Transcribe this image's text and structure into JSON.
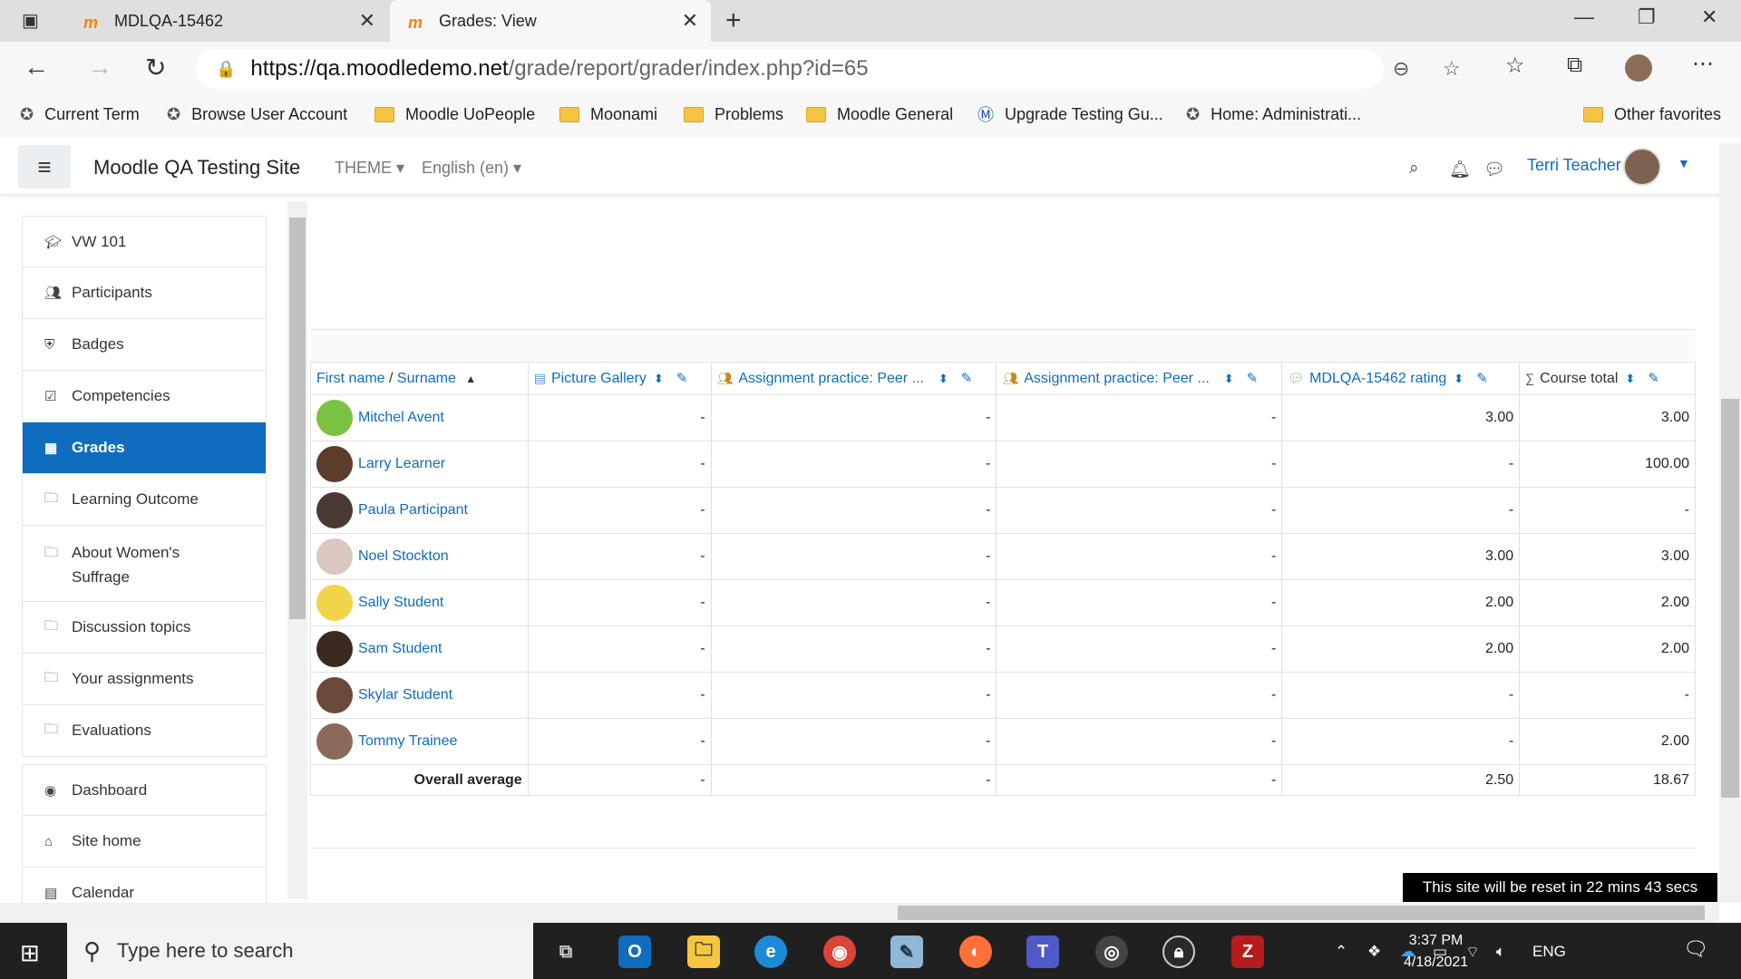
{
  "browser": {
    "tabs": [
      {
        "title": "MDLQA-15462"
      },
      {
        "title": "Grades: View"
      }
    ],
    "url_host": "https://qa.moodledemo.net",
    "url_path": "/grade/report/grader/index.php?id=65",
    "bookmarks": [
      "Current Term",
      "Browse User Account",
      "Moodle UoPeople",
      "Moonami",
      "Problems",
      "Moodle General",
      "Upgrade Testing Gu...",
      "Home: Administrati..."
    ],
    "other_favorites": "Other favorites"
  },
  "moodle": {
    "site_name": "Moodle QA Testing Site",
    "theme_menu": "THEME",
    "lang_menu": "English (en)",
    "user_name": "Terri Teacher"
  },
  "sidebar": {
    "items": [
      {
        "label": "VW 101",
        "icon": "graduation-cap-icon"
      },
      {
        "label": "Participants",
        "icon": "users-icon"
      },
      {
        "label": "Badges",
        "icon": "shield-icon"
      },
      {
        "label": "Competencies",
        "icon": "check-square-icon"
      },
      {
        "label": "Grades",
        "icon": "table-icon",
        "active": true
      },
      {
        "label": "Learning Outcome",
        "icon": "folder-icon"
      },
      {
        "label": "About Women's Suffrage",
        "icon": "folder-icon"
      },
      {
        "label": "Discussion topics",
        "icon": "folder-icon"
      },
      {
        "label": "Your assignments",
        "icon": "folder-icon"
      },
      {
        "label": "Evaluations",
        "icon": "folder-icon"
      },
      {
        "label": "Dashboard",
        "icon": "dashboard-icon"
      },
      {
        "label": "Site home",
        "icon": "home-icon"
      },
      {
        "label": "Calendar",
        "icon": "calendar-icon"
      }
    ]
  },
  "grader": {
    "name_header_first": "First name",
    "name_header_sep": " / ",
    "name_header_last": "Surname",
    "columns": [
      "Picture Gallery",
      "Assignment practice: Peer ...",
      "Assignment practice: Peer ...",
      "MDLQA-15462 rating",
      "Course total"
    ],
    "rows": [
      {
        "name": "Mitchel Avent",
        "grades": [
          "-",
          "-",
          "-",
          "3.00",
          "3.00"
        ],
        "avatar_color": "#7bc142"
      },
      {
        "name": "Larry Learner",
        "grades": [
          "-",
          "-",
          "-",
          "-",
          "100.00"
        ],
        "avatar_color": "#5a3d2b"
      },
      {
        "name": "Paula Participant",
        "grades": [
          "-",
          "-",
          "-",
          "-",
          "-"
        ],
        "avatar_color": "#4a3a36"
      },
      {
        "name": "Noel Stockton",
        "grades": [
          "-",
          "-",
          "-",
          "3.00",
          "3.00"
        ],
        "avatar_color": "#d9c7c0"
      },
      {
        "name": "Sally Student",
        "grades": [
          "-",
          "-",
          "-",
          "2.00",
          "2.00"
        ],
        "avatar_color": "#f2d44a"
      },
      {
        "name": "Sam Student",
        "grades": [
          "-",
          "-",
          "-",
          "2.00",
          "2.00"
        ],
        "avatar_color": "#3b2a20"
      },
      {
        "name": "Skylar Student",
        "grades": [
          "-",
          "-",
          "-",
          "-",
          "-"
        ],
        "avatar_color": "#6b4a3a"
      },
      {
        "name": "Tommy Trainee",
        "grades": [
          "-",
          "-",
          "-",
          "-",
          "2.00"
        ],
        "avatar_color": "#8c6a5a"
      }
    ],
    "average_label": "Overall average",
    "averages": [
      "-",
      "-",
      "-",
      "2.50",
      "18.67"
    ]
  },
  "reset_notice": "This site will be reset in 22 mins 43 secs",
  "taskbar": {
    "search_placeholder": "Type here to search",
    "lang": "ENG",
    "time": "3:37 PM",
    "date": "4/18/2021"
  }
}
